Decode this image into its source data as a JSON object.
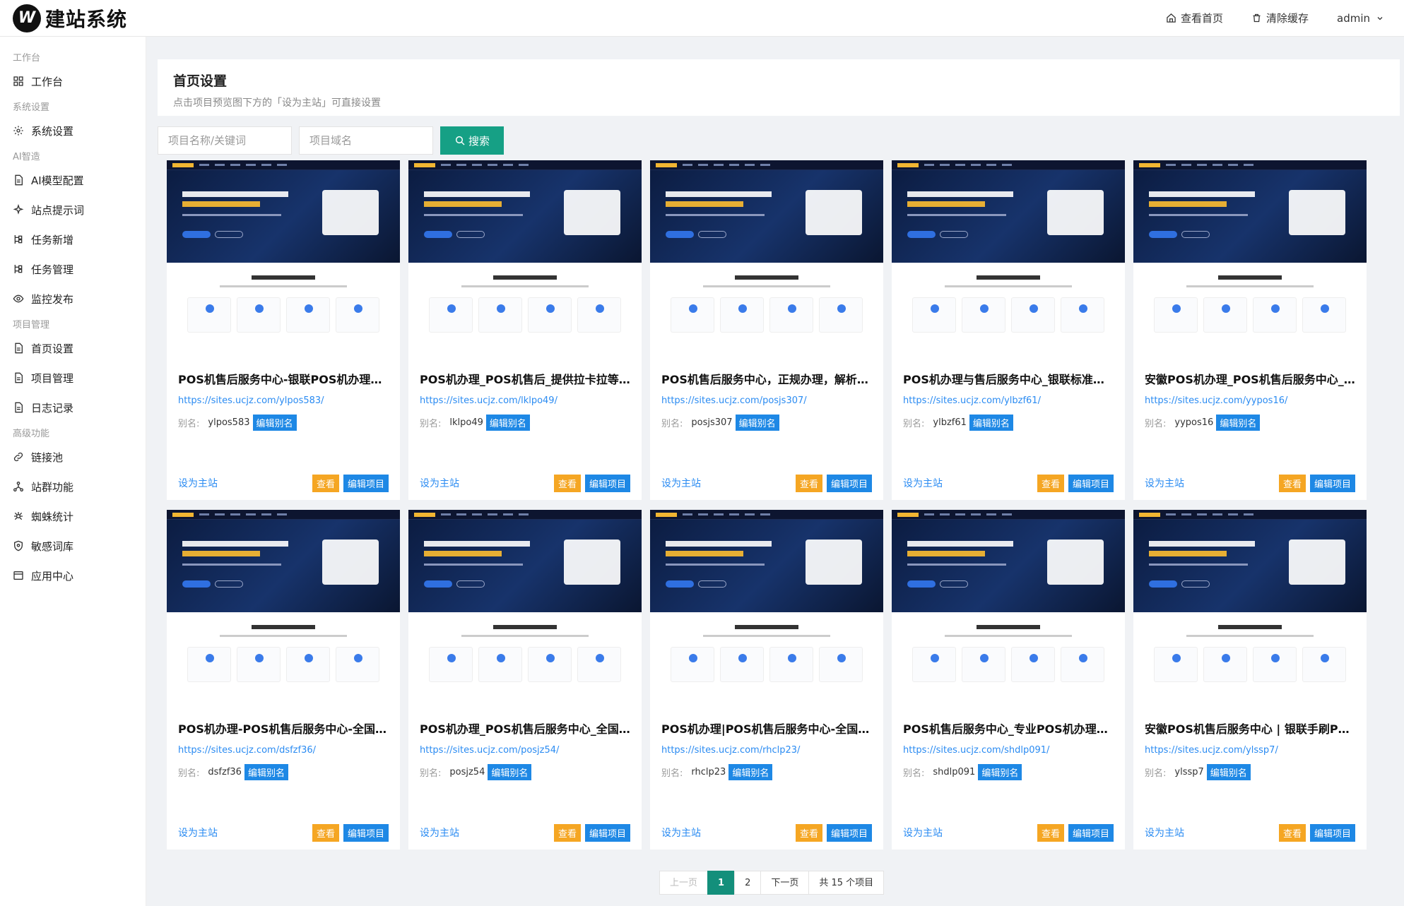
{
  "app": {
    "logo_text": "建站系统"
  },
  "topbar": {
    "home_label": "查看首页",
    "cache_label": "清除缓存",
    "user": "admin"
  },
  "sidebar": {
    "groups": [
      {
        "title": "工作台",
        "items": [
          {
            "label": "工作台",
            "icon": "grid-icon"
          }
        ]
      },
      {
        "title": "系统设置",
        "items": [
          {
            "label": "系统设置",
            "icon": "gear-icon"
          }
        ]
      },
      {
        "title": "AI智造",
        "items": [
          {
            "label": "AI模型配置",
            "icon": "document-icon"
          },
          {
            "label": "站点提示词",
            "icon": "sparkle-icon"
          },
          {
            "label": "任务新增",
            "icon": "tree-icon"
          },
          {
            "label": "任务管理",
            "icon": "tree-icon"
          },
          {
            "label": "监控发布",
            "icon": "eye-icon"
          }
        ]
      },
      {
        "title": "项目管理",
        "items": [
          {
            "label": "首页设置",
            "icon": "document-icon"
          },
          {
            "label": "项目管理",
            "icon": "document-icon"
          },
          {
            "label": "日志记录",
            "icon": "document-icon"
          }
        ]
      },
      {
        "title": "高级功能",
        "items": [
          {
            "label": "链接池",
            "icon": "link-icon"
          },
          {
            "label": "站群功能",
            "icon": "network-icon"
          },
          {
            "label": "蜘蛛统计",
            "icon": "spider-icon"
          },
          {
            "label": "敏感词库",
            "icon": "shield-icon"
          },
          {
            "label": "应用中心",
            "icon": "window-icon"
          }
        ]
      }
    ]
  },
  "page": {
    "title": "首页设置",
    "subtitle": "点击项目预览图下方的「设为主站」可直接设置"
  },
  "search": {
    "keyword_placeholder": "项目名称/关键词",
    "domain_placeholder": "项目域名",
    "button_label": "搜索"
  },
  "labels": {
    "alias": "别名:",
    "edit_alias": "编辑别名",
    "set_main": "设为主站",
    "view": "查看",
    "edit_project": "编辑项目"
  },
  "cards": [
    {
      "title": "POS机售后服务中心-银联POS机办理与...",
      "url": "https://sites.ucjz.com/ylpos583/",
      "alias": "ylpos583"
    },
    {
      "title": "POS机办理_POS机售后_提供拉卡拉等...",
      "url": "https://sites.ucjz.com/lklpo49/",
      "alias": "lklpo49"
    },
    {
      "title": "POS机售后服务中心，正规办理，解析p...",
      "url": "https://sites.ucjz.com/posjs307/",
      "alias": "posjs307"
    },
    {
      "title": "POS机办理与售后服务中心_银联标准费...",
      "url": "https://sites.ucjz.com/ylbzf61/",
      "alias": "ylbzf61"
    },
    {
      "title": "安徽POS机办理_POS机售后服务中心_...",
      "url": "https://sites.ucjz.com/yypos16/",
      "alias": "yypos16"
    },
    {
      "title": "POS机办理-POS机售后服务中心-全国持...",
      "url": "https://sites.ucjz.com/dsfzf36/",
      "alias": "dsfzf36"
    },
    {
      "title": "POS机办理_POS机售后服务中心_全国...",
      "url": "https://sites.ucjz.com/posjz54/",
      "alias": "posjz54"
    },
    {
      "title": "POS机办理|POS机售后服务中心-全国专...",
      "url": "https://sites.ucjz.com/rhclp23/",
      "alias": "rhclp23"
    },
    {
      "title": "POS机售后服务中心_专业POS机办理与...",
      "url": "https://sites.ucjz.com/shdlp091/",
      "alias": "shdlp091"
    },
    {
      "title": "安徽POS机售后服务中心 | 银联手刷PO...",
      "url": "https://sites.ucjz.com/ylssp7/",
      "alias": "ylssp7"
    }
  ],
  "pager": {
    "prev": "上一页",
    "page1": "1",
    "page2": "2",
    "next": "下一页",
    "total": "共 15 个项目"
  }
}
